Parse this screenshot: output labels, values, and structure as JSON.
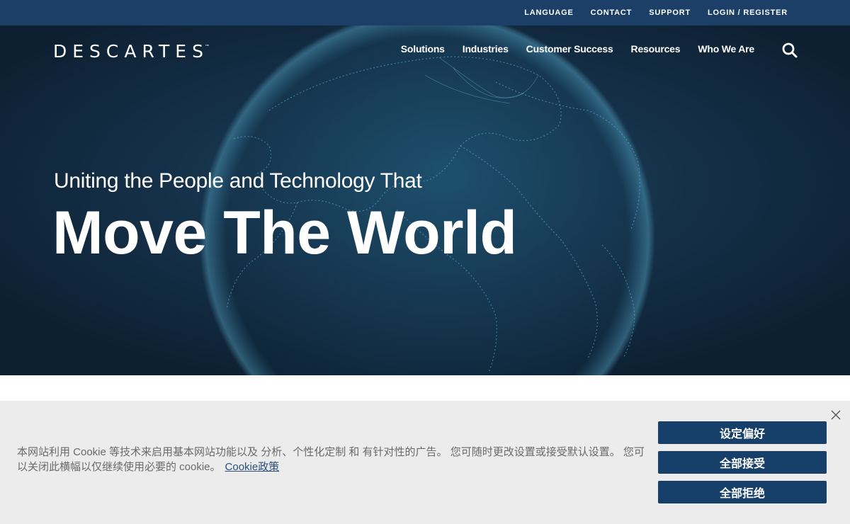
{
  "utility_nav": {
    "language": "LANGUAGE",
    "contact": "CONTACT",
    "support": "SUPPORT",
    "login": "LOGIN / REGISTER"
  },
  "brand": {
    "logo_text": "DESCARTES",
    "trademark": "™",
    "bar_color": "#1b3f66",
    "hero_color": "#0f2438",
    "accent_color": "#2f86c7"
  },
  "main_nav": {
    "items": [
      "Solutions",
      "Industries",
      "Customer Success",
      "Resources",
      "Who We Are"
    ],
    "search_icon": "search-icon"
  },
  "hero": {
    "subtitle": "Uniting the People and Technology That",
    "title": "Move The World"
  },
  "cookie": {
    "text": "本网站利用 Cookie 等技术来启用基本网站功能以及 分析、个性化定制 和 有针对性的广告。 您可随时更改设置或接受默认设置。 您可以关闭此横幅以仅继续使用必要的 cookie。",
    "policy_link": "Cookie政策",
    "prefs_button": "设定偏好",
    "accept_button": "全部接受",
    "reject_button": "全部拒绝",
    "close_icon": "close-icon",
    "button_color": "#16406a"
  }
}
